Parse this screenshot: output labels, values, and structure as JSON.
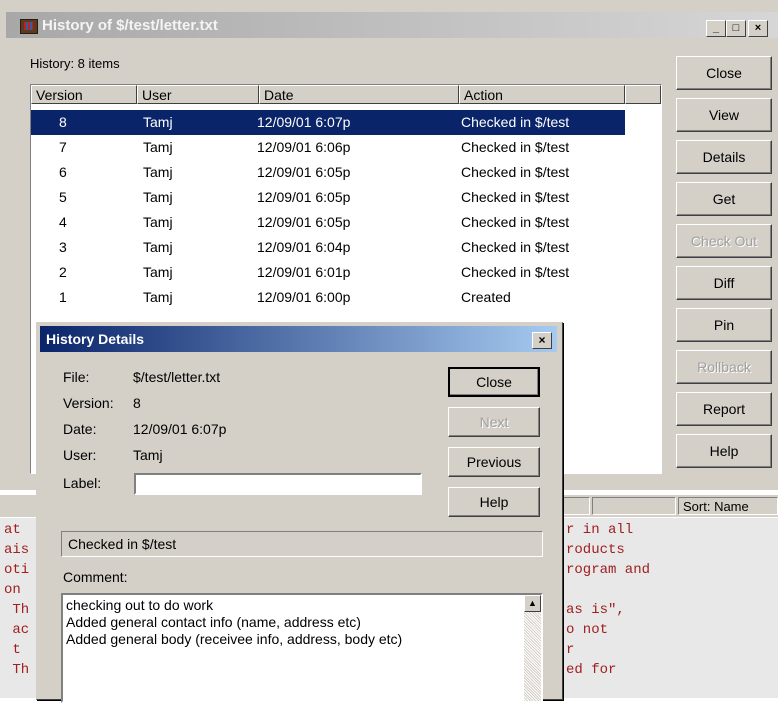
{
  "window": {
    "title": "History of $/test/letter.txt",
    "minimize": "_",
    "maximize": "□",
    "close": "×"
  },
  "history_count": "History: 8 items",
  "list": {
    "columns": [
      "Version",
      "User",
      "Date",
      "Action"
    ],
    "rows": [
      {
        "version": "8",
        "user": "Tamj",
        "date": "12/09/01  6:07p",
        "action": "Checked in $/test",
        "selected": true
      },
      {
        "version": "7",
        "user": "Tamj",
        "date": "12/09/01  6:06p",
        "action": "Checked in $/test"
      },
      {
        "version": "6",
        "user": "Tamj",
        "date": "12/09/01  6:05p",
        "action": "Checked in $/test"
      },
      {
        "version": "5",
        "user": "Tamj",
        "date": "12/09/01  6:05p",
        "action": "Checked in $/test"
      },
      {
        "version": "4",
        "user": "Tamj",
        "date": "12/09/01  6:05p",
        "action": "Checked in $/test"
      },
      {
        "version": "3",
        "user": "Tamj",
        "date": "12/09/01  6:04p",
        "action": "Checked in $/test"
      },
      {
        "version": "2",
        "user": "Tamj",
        "date": "12/09/01  6:01p",
        "action": "Checked in $/test"
      },
      {
        "version": "1",
        "user": "Tamj",
        "date": "12/09/01  6:00p",
        "action": "Created"
      }
    ]
  },
  "buttons": {
    "close": "Close",
    "view": "View",
    "details": "Details",
    "get": "Get",
    "check_out": "Check Out",
    "diff": "Diff",
    "pin": "Pin",
    "rollback": "Rollback",
    "report": "Report",
    "help": "Help"
  },
  "status": {
    "sort": "Sort: Name"
  },
  "code_lines": [
    {
      "left": "at ",
      "right": "r in all"
    },
    {
      "left": "ais",
      "right": "roducts"
    },
    {
      "left": "oti",
      "right": "rogram and"
    },
    {
      "left": "on ",
      "right": ""
    },
    {
      "left": " Th",
      "right": "as is\","
    },
    {
      "left": " ac",
      "right": "o not"
    },
    {
      "left": " t ",
      "right": "r"
    },
    {
      "left": " Th",
      "right": "ed for"
    }
  ],
  "details": {
    "title": "History Details",
    "close_x": "×",
    "file_label": "File:",
    "file_value": "$/test/letter.txt",
    "version_label": "Version:",
    "version_value": "8",
    "date_label": "Date:",
    "date_value": "12/09/01   6:07p",
    "user_label": "User:",
    "user_value": "Tamj",
    "label_label": "Label:",
    "label_value": "",
    "buttons": {
      "close": "Close",
      "next": "Next",
      "previous": "Previous",
      "help": "Help"
    },
    "action": "Checked in $/test",
    "comment_label": "Comment:",
    "comment_lines": [
      "checking out to do work",
      "Added general contact info (name, address etc)",
      "Added general body (receivee info, address, body etc)"
    ]
  }
}
